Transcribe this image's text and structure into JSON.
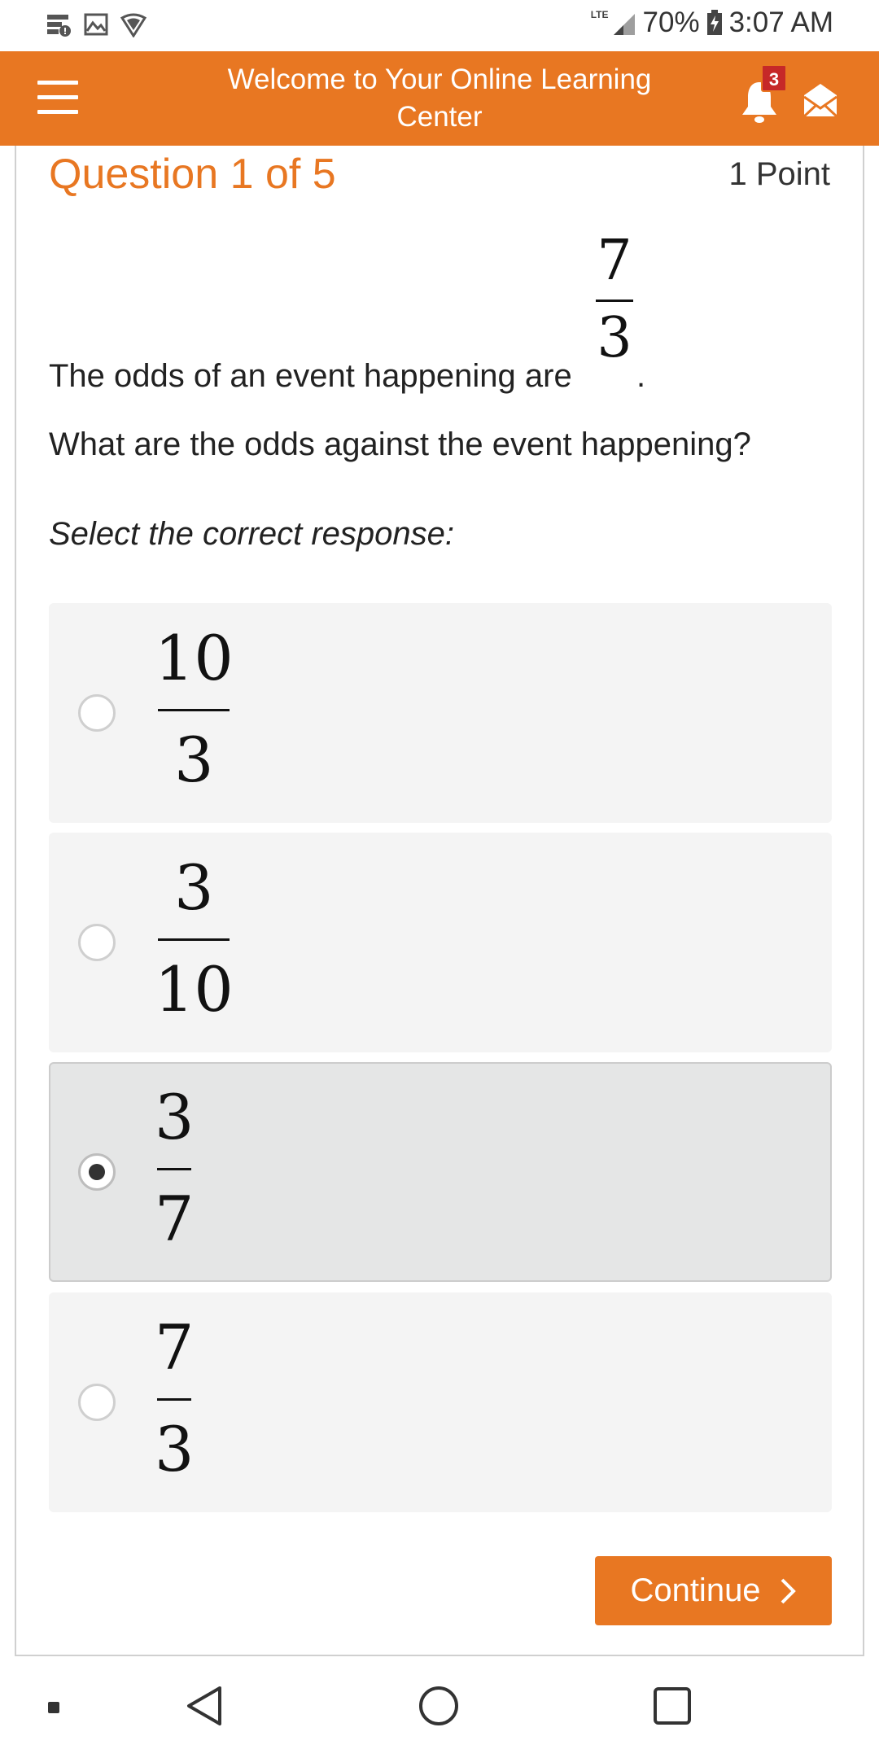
{
  "status_bar": {
    "network": "LTE",
    "battery": "70%",
    "time": "3:07 AM"
  },
  "header": {
    "title": "Welcome to Your Online Learning Center",
    "notification_count": "3"
  },
  "question": {
    "title": "Question 1 of 5",
    "points": "1 Point",
    "stem_prefix": "The odds of an event happening are",
    "stem_fraction": {
      "numerator": "7",
      "denominator": "3"
    },
    "stem_suffix": ".",
    "prompt": "What are the odds against the event happening?",
    "instruction": "Select the correct response:"
  },
  "options": [
    {
      "numerator": "10",
      "denominator": "3",
      "selected": false
    },
    {
      "numerator": "3",
      "denominator": "10",
      "selected": false
    },
    {
      "numerator": "3",
      "denominator": "7",
      "selected": true
    },
    {
      "numerator": "7",
      "denominator": "3",
      "selected": false
    }
  ],
  "actions": {
    "continue_label": "Continue"
  },
  "colors": {
    "accent": "#e87722",
    "badge": "#c62828",
    "option_bg": "#f4f4f4",
    "option_selected_bg": "#e5e6e6"
  },
  "icons": {
    "status_left": [
      "sim-card-icon",
      "gallery-icon",
      "shield-icon"
    ],
    "header": [
      "menu-icon",
      "bell-icon",
      "mail-icon"
    ],
    "nav": [
      "recents-dot-icon",
      "back-icon",
      "home-icon",
      "overview-icon"
    ]
  }
}
